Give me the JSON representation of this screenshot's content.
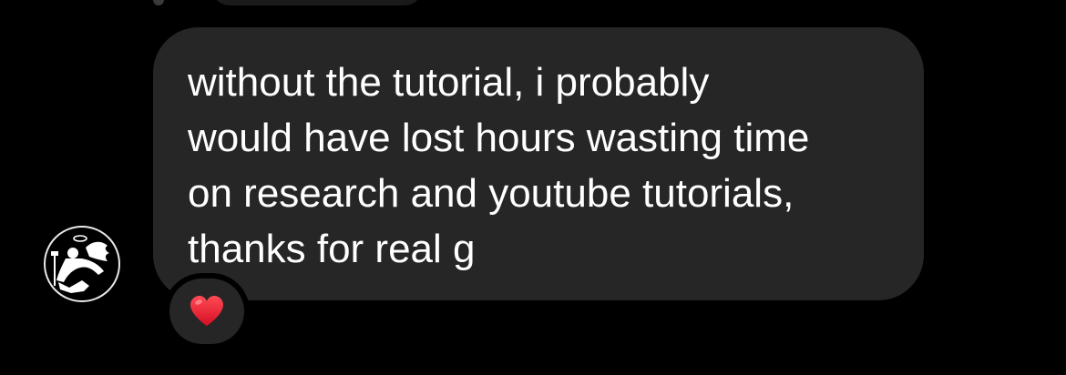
{
  "message": {
    "text": "without the tutorial, i probably\nwould have lost hours wasting time\non research and youtube tutorials,\nthanks for real g"
  },
  "reaction": {
    "emoji_icon": "red-heart-icon",
    "color": "#e8112d"
  },
  "avatar": {
    "icon": "angel-figure-avatar"
  },
  "colors": {
    "background": "#000000",
    "bubble": "#262626",
    "text": "#ffffff"
  }
}
